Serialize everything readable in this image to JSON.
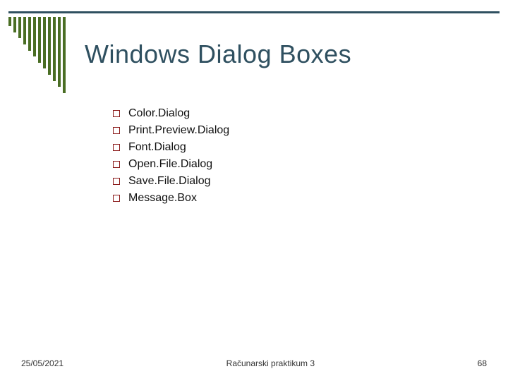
{
  "title": "Windows Dialog Boxes",
  "bullets": [
    "Color.Dialog",
    "Print.Preview.Dialog",
    "Font.Dialog",
    "Open.File.Dialog",
    "Save.File.Dialog",
    "Message.Box"
  ],
  "footer": {
    "date": "25/05/2021",
    "course": "Računarski praktikum 3",
    "page": "68"
  }
}
